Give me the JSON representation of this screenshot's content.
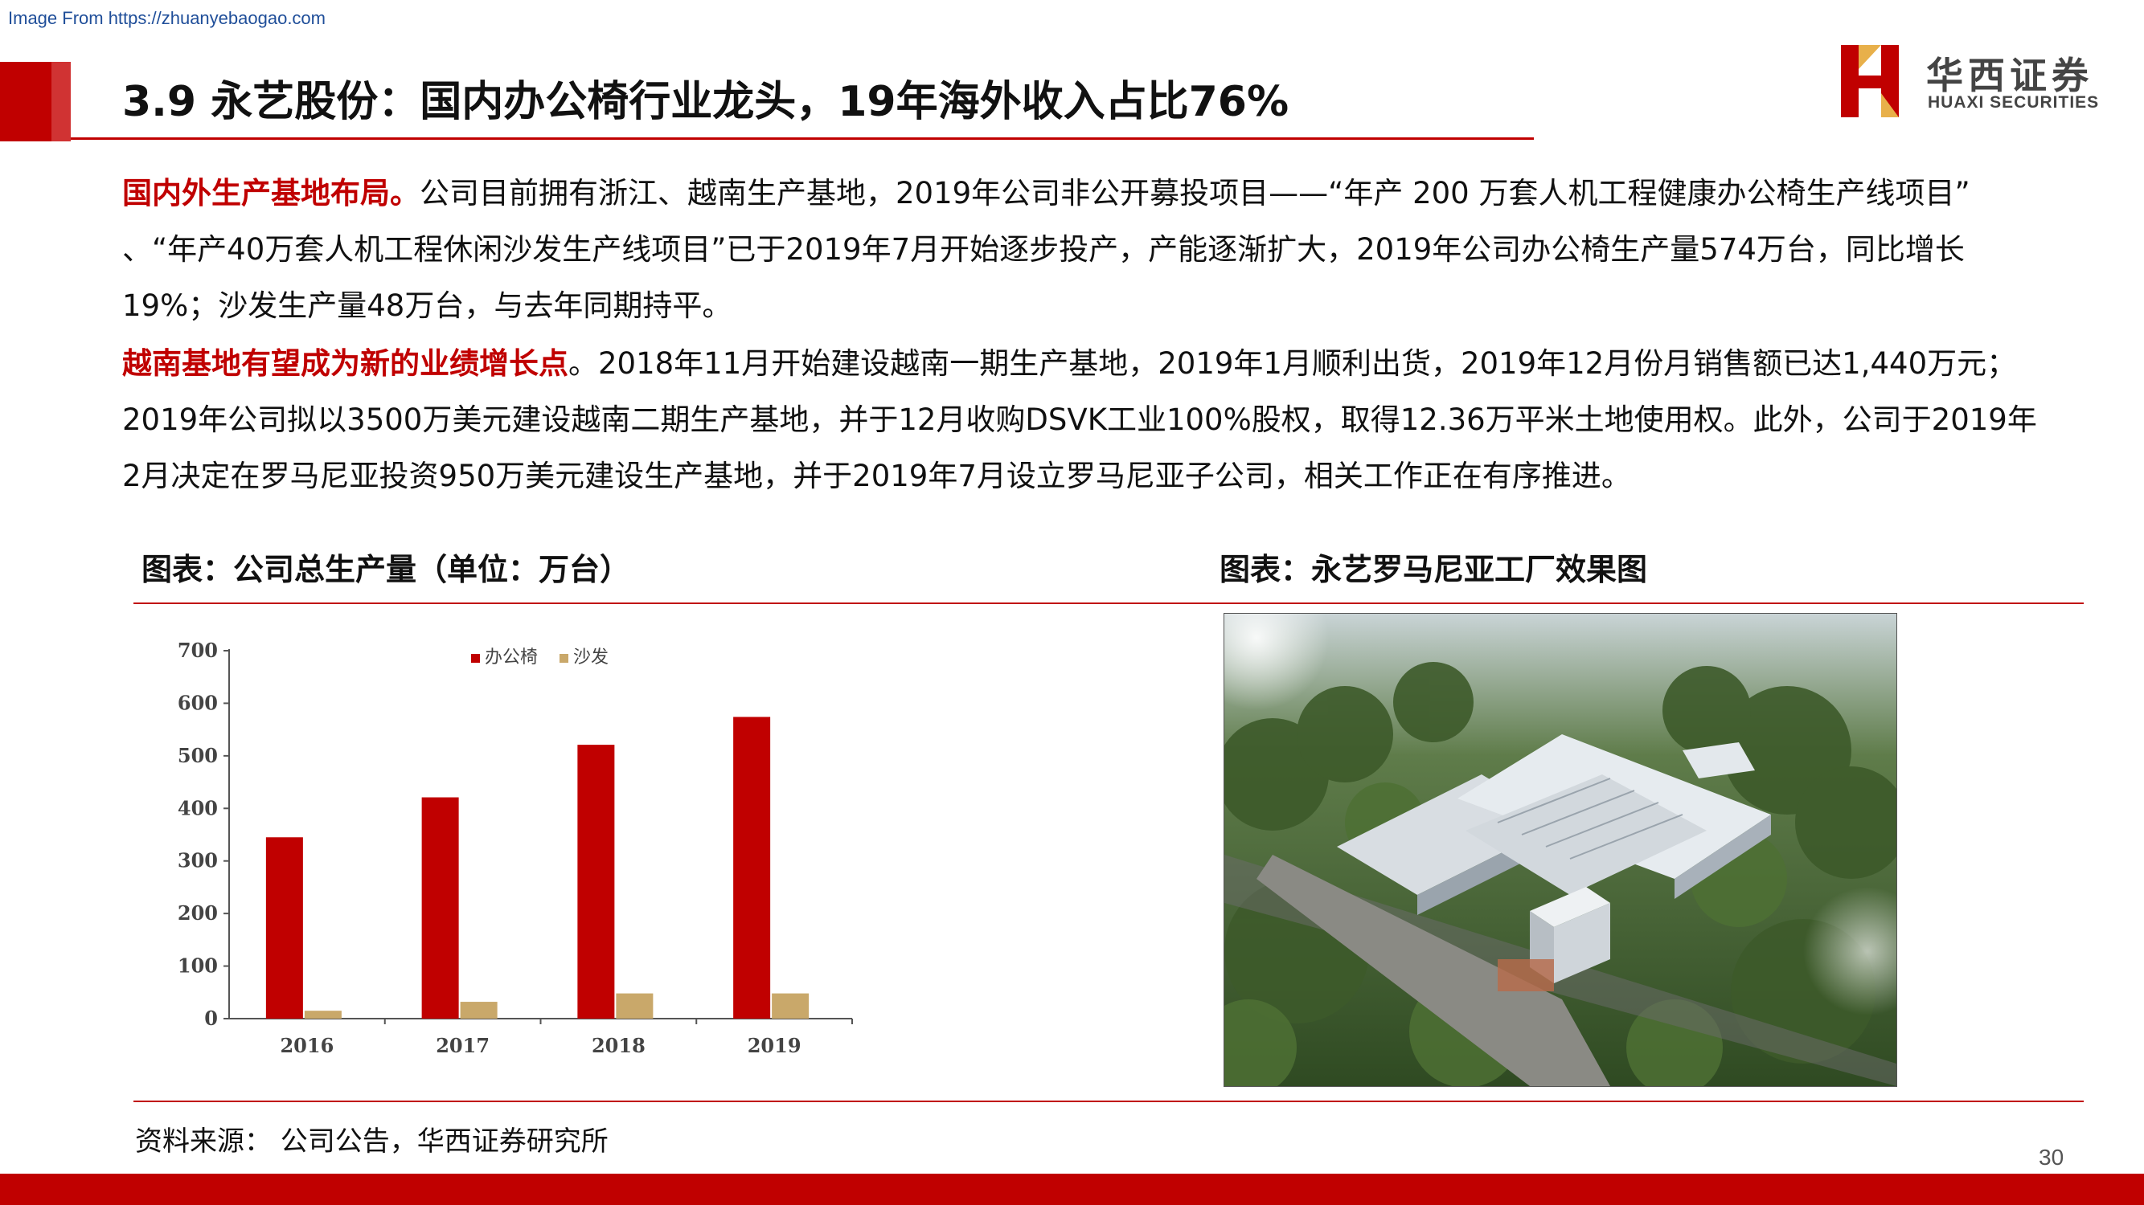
{
  "watermark": "Image From https://zhuanyebaogao.com",
  "header": {
    "title": "3.9 永艺股份：国内办公椅行业龙头，19年海外收入占比76%",
    "logo_cn": "华西证券",
    "logo_en": "HUAXI SECURITIES",
    "accent_color": "#c00000"
  },
  "paragraphs": [
    {
      "highlight": "国内外生产基地布局。",
      "text": "公司目前拥有浙江、越南生产基地，2019年公司非公开募投项目——“年产 200 万套人机工程健康办公椅生产线项目” 、“年产40万套人机工程休闲沙发生产线项目”已于2019年7月开始逐步投产，产能逐渐扩大，2019年公司办公椅生产量574万台，同比增长19%；沙发生产量48万台，与去年同期持平。"
    },
    {
      "highlight": "越南基地有望成为新的业绩增长点",
      "text": "。2018年11月开始建设越南一期生产基地，2019年1月顺利出货，2019年12月份月销售额已达1,440万元；2019年公司拟以3500万美元建设越南二期生产基地，并于12月收购DSVK工业100%股权，取得12.36万平米土地使用权。此外，公司于2019年2月决定在罗马尼亚投资950万美元建设生产基地，并于2019年7月设立罗马尼亚子公司，相关工作正在有序推进。"
    }
  ],
  "chart_title": "图表：公司总生产量（单位：万台）",
  "photo_title": "图表：永艺罗马尼亚工厂效果图",
  "chart_data": {
    "type": "bar",
    "title": "",
    "xlabel": "",
    "ylabel": "",
    "categories": [
      "2016",
      "2017",
      "2018",
      "2019"
    ],
    "series": [
      {
        "name": "办公椅",
        "values": [
          345,
          421,
          521,
          574
        ],
        "color": "#c00000"
      },
      {
        "name": "沙发",
        "values": [
          15,
          32,
          48,
          48
        ],
        "color": "#c9a86a"
      }
    ],
    "ylim": [
      0,
      700
    ],
    "yticks": [
      "0",
      "100",
      "200",
      "300",
      "400",
      "500",
      "600",
      "700"
    ],
    "legend_position": "top",
    "grid": false
  },
  "source": "资料来源： 公司公告，华西证券研究所",
  "page_number": "30"
}
